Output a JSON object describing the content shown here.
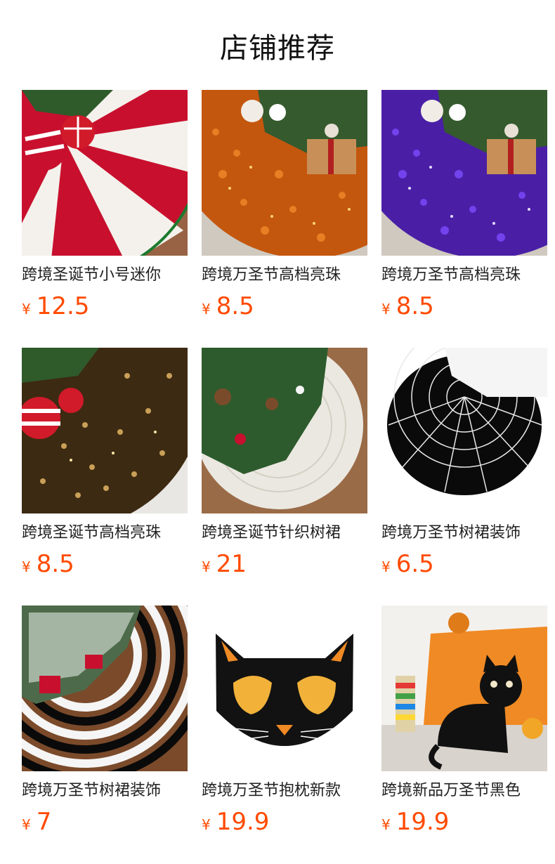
{
  "page": {
    "title": "店铺推荐"
  },
  "currency_symbol": "¥",
  "accent_color": "#ff4a00",
  "products": [
    {
      "name": "跨境圣诞节小号迷你",
      "price": "12.5",
      "image": "red-white-swirl-tree-skirt"
    },
    {
      "name": "跨境万圣节高档亮珠",
      "price": "8.5",
      "image": "orange-sequin-tree-skirt"
    },
    {
      "name": "跨境万圣节高档亮珠",
      "price": "8.5",
      "image": "purple-sequin-tree-skirt"
    },
    {
      "name": "跨境圣诞节高档亮珠",
      "price": "8.5",
      "image": "gold-sequin-tree-skirt"
    },
    {
      "name": "跨境圣诞节针织树裙",
      "price": "21",
      "image": "white-knit-tree-skirt"
    },
    {
      "name": "跨境万圣节树裙装饰",
      "price": "6.5",
      "image": "spiderweb-tree-skirt"
    },
    {
      "name": "跨境万圣节树裙装饰",
      "price": "7",
      "image": "black-white-stripe-tree-skirt"
    },
    {
      "name": "跨境万圣节抱枕新款",
      "price": "19.9",
      "image": "black-cat-face-pillow"
    },
    {
      "name": "跨境新品万圣节黑色",
      "price": "19.9",
      "image": "black-cat-plush-pillow"
    }
  ]
}
